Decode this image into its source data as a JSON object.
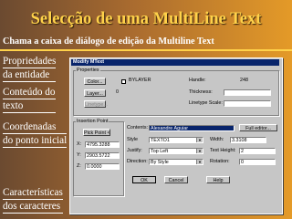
{
  "slide": {
    "title": "Selecção de uma MultiLine Text",
    "subtitle": "Chama a caixa de diálogo de edição da Multiline Text",
    "labels": [
      {
        "line1": "Propriedades",
        "line2": "da entidade"
      },
      {
        "line1": "Conteúdo do",
        "line2": "texto"
      },
      {
        "line1": "Coordenadas",
        "line2": "do ponto inicial"
      },
      {
        "line1": "Características",
        "line2": "dos caracteres"
      }
    ]
  },
  "dialog": {
    "title": "Modify MText",
    "properties": {
      "group_label": "Properties",
      "color_button": "Color...",
      "color_value": "BYLAYER",
      "layer_button": "Layer...",
      "layer_value": "0",
      "linetype_button": "Linetype...",
      "handle_label": "Handle:",
      "handle_value": "248",
      "thickness_label": "Thickness:",
      "linetype_scale_label": "Linetype Scale:"
    },
    "insertion_point": {
      "group_label": "Insertion Point",
      "pick_button": "Pick Point <",
      "x_label": "X:",
      "x_value": "4795.3288",
      "y_label": "Y:",
      "y_value": "2903.5722",
      "z_label": "Z:",
      "z_value": "0.0000"
    },
    "contents_label": "Contents:",
    "contents_value": "Alexandre Aguiar",
    "full_editor_button": "Full editor...",
    "style_label": "Style",
    "style_value": "TEXTO1",
    "justify_label": "Justify:",
    "justify_value": "Top Left",
    "direction_label": "Direction:",
    "direction_value": "By Style",
    "width_label": "Width:",
    "width_value": "3.3108",
    "text_height_label": "Text Height:",
    "text_height_value": "2",
    "rotation_label": "Rotation:",
    "rotation_value": "0",
    "ok_button": "OK",
    "cancel_button": "Cancel",
    "help_button": "Help"
  }
}
